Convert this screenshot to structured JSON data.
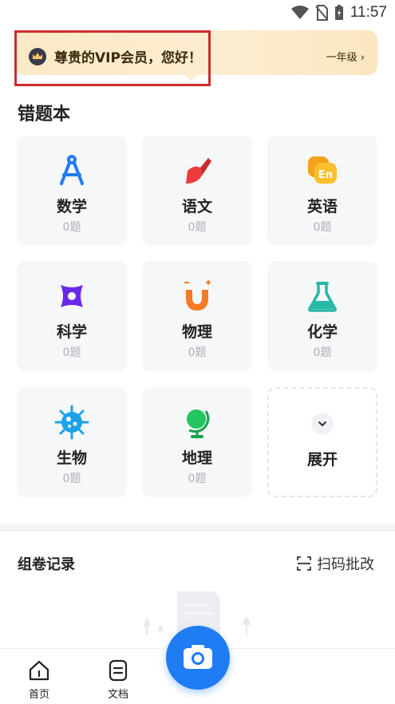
{
  "status_bar": {
    "time": "11:57"
  },
  "vip_banner": {
    "greeting": "尊贵的VIP会员，您好！",
    "grade": "一年级 ›"
  },
  "wrong_book": {
    "title": "错题本",
    "subjects": [
      {
        "name": "数学",
        "count": "0题",
        "icon": "compass-icon",
        "color": "#1f7cf2"
      },
      {
        "name": "语文",
        "count": "0题",
        "icon": "brush-icon",
        "color": "#ef3b3b"
      },
      {
        "name": "英语",
        "count": "0题",
        "icon": "english-icon",
        "color": "#f6a21a"
      },
      {
        "name": "科学",
        "count": "0题",
        "icon": "atom-icon",
        "color": "#6a28e8"
      },
      {
        "name": "物理",
        "count": "0题",
        "icon": "magnet-icon",
        "color": "#f47b20"
      },
      {
        "name": "化学",
        "count": "0题",
        "icon": "flask-icon",
        "color": "#27b9a5"
      },
      {
        "name": "生物",
        "count": "0题",
        "icon": "virus-icon",
        "color": "#1aa3e8"
      },
      {
        "name": "地理",
        "count": "0题",
        "icon": "globe-icon",
        "color": "#22c55e"
      }
    ],
    "expand_label": "展开"
  },
  "records": {
    "title": "组卷记录",
    "scan_label": "扫码批改"
  },
  "bottom_nav": {
    "home_label": "首页",
    "docs_label": "文档"
  }
}
